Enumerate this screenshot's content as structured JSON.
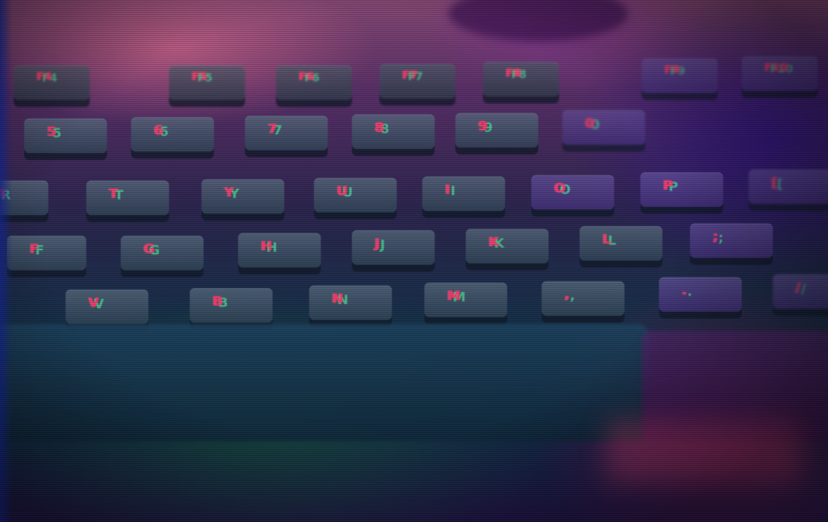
{
  "scene": {
    "description_tag": "keyboard-photo",
    "accent_colors": {
      "glyph": "#ff3c6e",
      "glow_green": "#50e6a0",
      "glow_purple": "#5a2f6a"
    }
  },
  "keys": {
    "fn_row": [
      "F4",
      "F5",
      "F6",
      "F7",
      "F8",
      "F9",
      "F10"
    ],
    "num_row": [
      "5",
      "6",
      "7",
      "8",
      "9",
      "0"
    ],
    "top_row": [
      "R",
      "T",
      "Y",
      "U",
      "I",
      "O",
      "P",
      "["
    ],
    "home_row": [
      "F",
      "G",
      "H",
      "J",
      "K",
      "L",
      ";"
    ],
    "bottom_row": [
      "V",
      "B",
      "N",
      "M",
      ",",
      ".",
      "/"
    ]
  }
}
